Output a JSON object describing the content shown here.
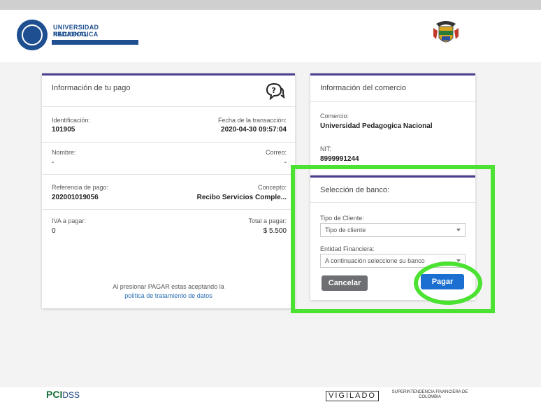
{
  "header": {
    "university_line1": "UNIVERSIDAD PEDAGOGICA",
    "university_line2": "NACIONAL"
  },
  "payment_info": {
    "title": "Información de tu pago",
    "identificacion_label": "Identificación:",
    "identificacion_value": "101905",
    "fecha_label": "Fecha de la transacción:",
    "fecha_value": "2020-04-30 09:57:04",
    "nombre_label": "Nombre:",
    "nombre_value": "-",
    "correo_label": "Correo:",
    "correo_value": "-",
    "referencia_label": "Referencia de pago:",
    "referencia_value": "202001019056",
    "concepto_label": "Concepto:",
    "concepto_value": "Recibo Servicios Comple...",
    "iva_label": "IVA a pagar:",
    "iva_value": "0",
    "total_label": "Total a pagar:",
    "total_value": "$ 5.500",
    "notice_text": "Al presionar PAGAR estas aceptando la",
    "notice_link": "política de tratamiento de datos"
  },
  "merchant_info": {
    "title": "Información del comercio",
    "comercio_label": "Comercio:",
    "comercio_value": "Universidad Pedagogica Nacional",
    "nit_label": "NIT:",
    "nit_value": "8999991244"
  },
  "bank_selection": {
    "title": "Selección de banco:",
    "tipo_cliente_label": "Tipo de Cliente:",
    "tipo_cliente_value": "Tipo de cliente",
    "entidad_label": "Entidad Financiera:",
    "entidad_value": "A continuación seleccione su banco",
    "cancel_label": "Cancelar",
    "pay_label": "Pagar"
  },
  "footer": {
    "pci_main": "PCI",
    "pci_sub": "DSS",
    "vigilado": "VIGILADO",
    "sfc": "SUPERINTENDENCIA FINANCIERA DE COLOMBIA"
  },
  "colors": {
    "accent": "#4a3f8f",
    "pay_button": "#1a6fd1",
    "highlight": "#4be232"
  }
}
